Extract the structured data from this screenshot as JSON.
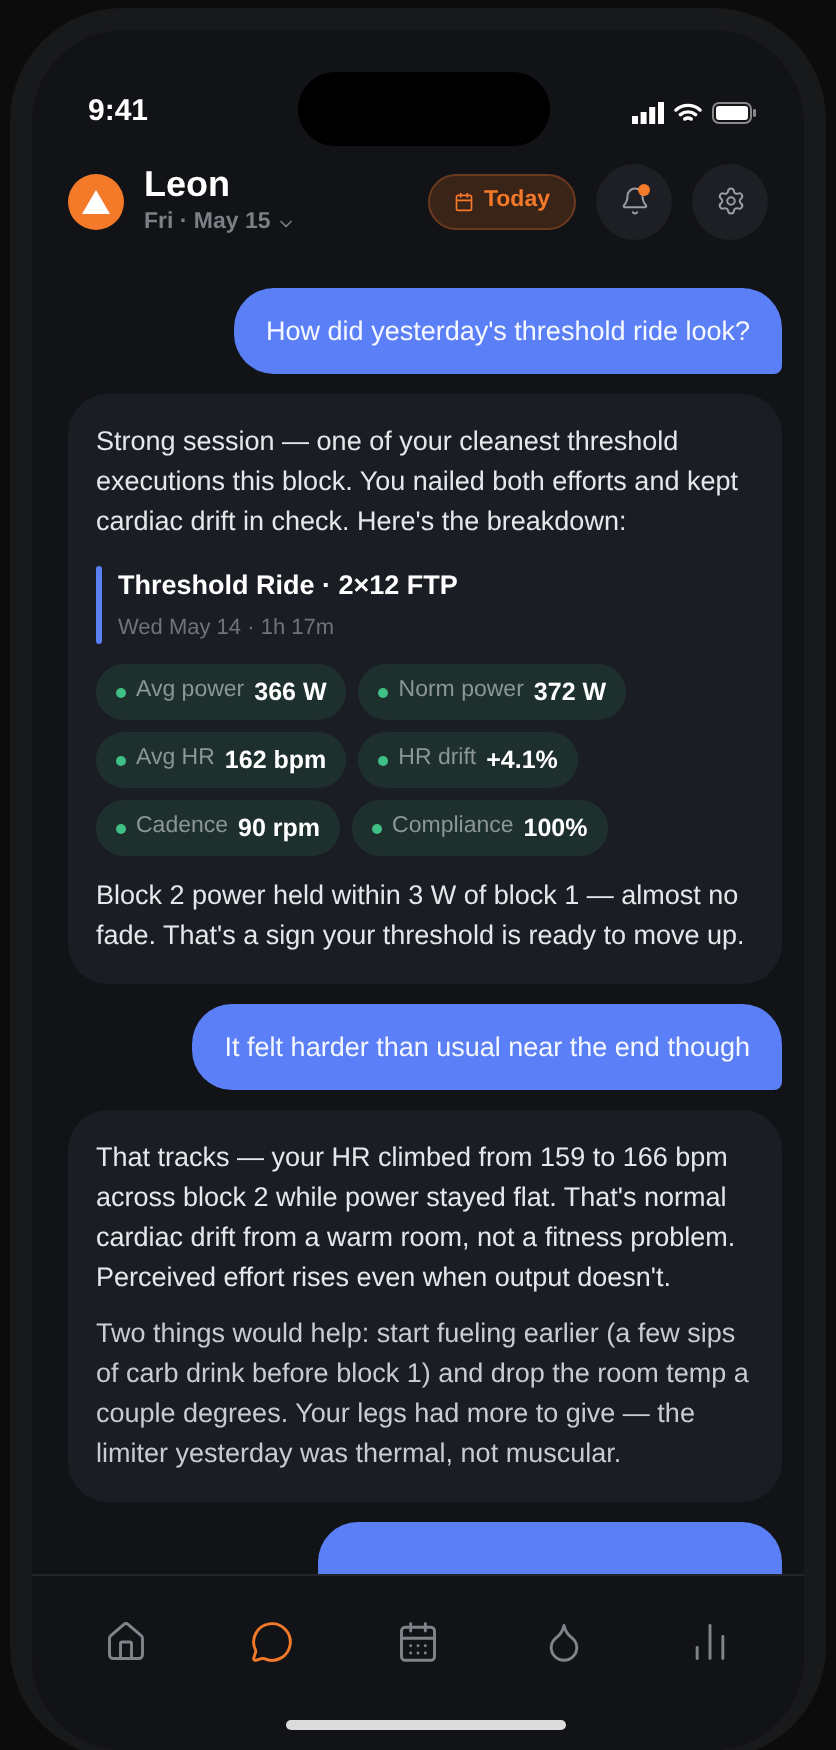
{
  "status_bar": {
    "time": "9:41"
  },
  "header": {
    "name": "Leon",
    "date": "Fri · May 15",
    "today_button": "Today",
    "notification_unread": true
  },
  "messages": [
    {
      "kind": "user",
      "text": "How did yesterday's threshold ride look?"
    },
    {
      "kind": "assistant",
      "paragraphs": [
        "Strong session — one of your cleanest threshold executions this block. You nailed both efforts and kept cardiac drift in check. Here's the breakdown:"
      ],
      "workout": {
        "title": "Threshold Ride · 2×12 FTP",
        "subtitle": "Wed May 14 · 1h 17m",
        "metrics": [
          {
            "label": "Avg power",
            "value": "366 W"
          },
          {
            "label": "Norm power",
            "value": "372 W"
          },
          {
            "label": "Avg HR",
            "value": "162 bpm"
          },
          {
            "label": "HR drift",
            "value": "+4.1%"
          },
          {
            "label": "Cadence",
            "value": "90 rpm"
          },
          {
            "label": "Compliance",
            "value": "100%"
          }
        ]
      },
      "closing": "Block 2 power held within 3 W of block 1 — almost no fade. That's a sign your threshold is ready to move up."
    },
    {
      "kind": "user",
      "text": "It felt harder than usual near the end though"
    },
    {
      "kind": "assistant",
      "paragraphs": [
        "That tracks — your HR climbed from 159 to 166 bpm across block 2 while power stayed flat. That's normal cardiac drift from a warm room, not a fitness problem. Perceived effort rises even when output doesn't.",
        "Two things would help: start fueling earlier (a few sips of carb drink before block 1) and drop the room temp a couple degrees. Your legs had more to give — the limiter yesterday was thermal, not muscular."
      ]
    },
    {
      "kind": "user"
    }
  ],
  "tab_bar": [
    {
      "kind": "home",
      "selected": false
    },
    {
      "kind": "chat",
      "selected": true
    },
    {
      "kind": "calendar",
      "selected": false
    },
    {
      "kind": "drop",
      "selected": false
    },
    {
      "kind": "stats",
      "selected": false
    }
  ]
}
